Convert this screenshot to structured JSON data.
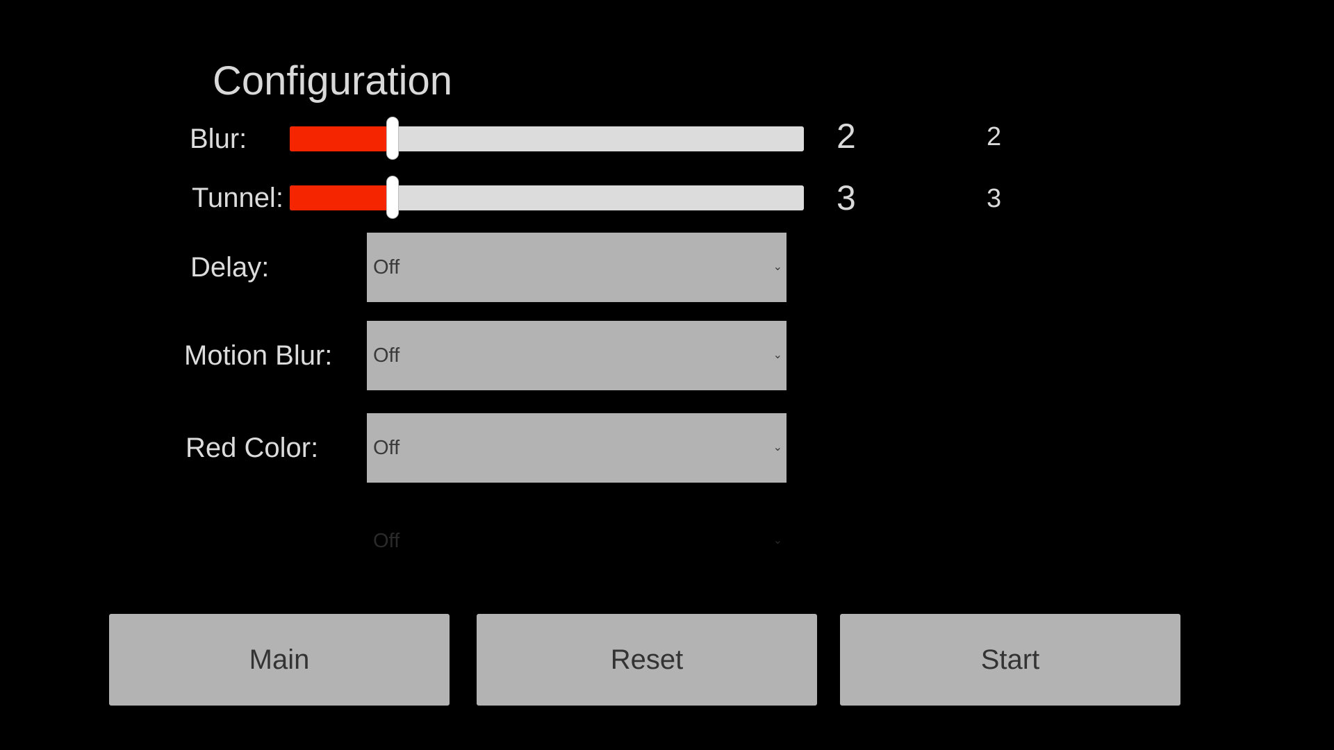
{
  "title": "Configuration",
  "sliders": [
    {
      "label": "Blur:",
      "value": 2,
      "value_display": "2",
      "secondary_display": "2",
      "fill_fraction": 0.2
    },
    {
      "label": "Tunnel:",
      "value": 3,
      "value_display": "3",
      "secondary_display": "3",
      "fill_fraction": 0.2
    }
  ],
  "dropdowns": [
    {
      "label": "Delay:",
      "selected": "Off"
    },
    {
      "label": "Motion Blur:",
      "selected": "Off"
    },
    {
      "label": "Red Color:",
      "selected": "Off"
    },
    {
      "label": "",
      "selected": "Off"
    }
  ],
  "buttons": {
    "main": "Main",
    "reset": "Reset",
    "start": "Start"
  },
  "colors": {
    "background": "#000000",
    "slider_fill": "#f52500",
    "slider_track": "#dcdcdc",
    "control_gray": "#b3b3b3"
  },
  "icons": {
    "dropdown_arrow": "chevron-down-icon"
  }
}
